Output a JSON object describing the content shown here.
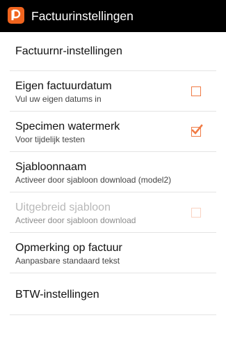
{
  "actionbar": {
    "title": "Factuurinstellingen",
    "icon": "app-logo-icon",
    "icon_color": "#f0641e"
  },
  "settings": [
    {
      "title": "Factuurnr-instellingen"
    },
    {
      "title": "Eigen factuurdatum",
      "summary": "Vul uw eigen datums in",
      "checked": false,
      "enabled": true
    },
    {
      "title": "Specimen watermerk",
      "summary": "Voor tijdelijk testen",
      "checked": true,
      "enabled": true
    },
    {
      "title": "Sjabloonnaam",
      "summary": "Activeer door sjabloon download (model2)"
    },
    {
      "title": "Uitgebreid sjabloon",
      "summary": "Activeer door sjabloon download",
      "checked": false,
      "enabled": false
    },
    {
      "title": "Opmerking op factuur",
      "summary": "Aanpasbare standaard tekst"
    },
    {
      "title": "BTW-instellingen"
    }
  ],
  "colors": {
    "accent": "#f07b45",
    "actionbar_bg": "#000000",
    "divider": "#e4e4e4"
  }
}
